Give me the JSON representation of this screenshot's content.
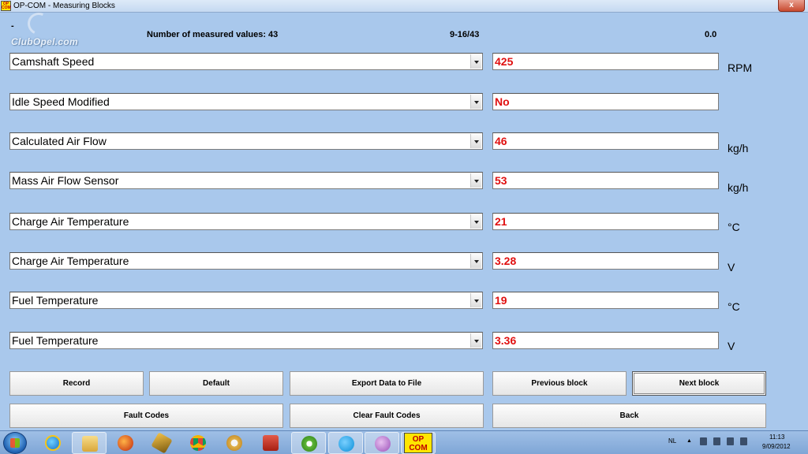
{
  "window": {
    "title": "OP-COM - Measuring Blocks",
    "app_icon_text": "OP COM",
    "close_label": "x"
  },
  "header": {
    "dash": "-",
    "logo_text": "ClubOpel.com",
    "count_label": "Number of measured values: 43",
    "range": "9-16/43",
    "value": "0.0"
  },
  "rows": [
    {
      "name": "Camshaft Speed",
      "value": "425",
      "unit": "RPM"
    },
    {
      "name": "Idle Speed Modified",
      "value": "No",
      "unit": ""
    },
    {
      "name": "Calculated Air Flow",
      "value": "46",
      "unit": "kg/h"
    },
    {
      "name": "Mass Air Flow Sensor",
      "value": "53",
      "unit": "kg/h"
    },
    {
      "name": "Charge Air Temperature",
      "value": "21",
      "unit": "°C"
    },
    {
      "name": "Charge Air Temperature",
      "value": "3.28",
      "unit": "V"
    },
    {
      "name": "Fuel Temperature",
      "value": "19",
      "unit": "°C"
    },
    {
      "name": "Fuel Temperature",
      "value": "3.36",
      "unit": "V"
    }
  ],
  "buttons": {
    "record": "Record",
    "default": "Default",
    "export": "Export Data to File",
    "previous": "Previous block",
    "next": "Next block",
    "fault_codes": "Fault Codes",
    "clear_fault_codes": "Clear Fault Codes",
    "back": "Back"
  },
  "taskbar": {
    "apps": [
      "start-icon",
      "ie-icon",
      "explorer-icon",
      "firefox-icon",
      "winamp-icon",
      "chrome-icon",
      "paint-icon",
      "media-icon",
      "utorrent-icon",
      "skype-icon",
      "messenger-icon",
      "opcom-icon"
    ],
    "opcom_label_top": "OP",
    "opcom_label_bottom": "COM",
    "language": "NL",
    "time": "11:13",
    "date": "9/09/2012"
  }
}
